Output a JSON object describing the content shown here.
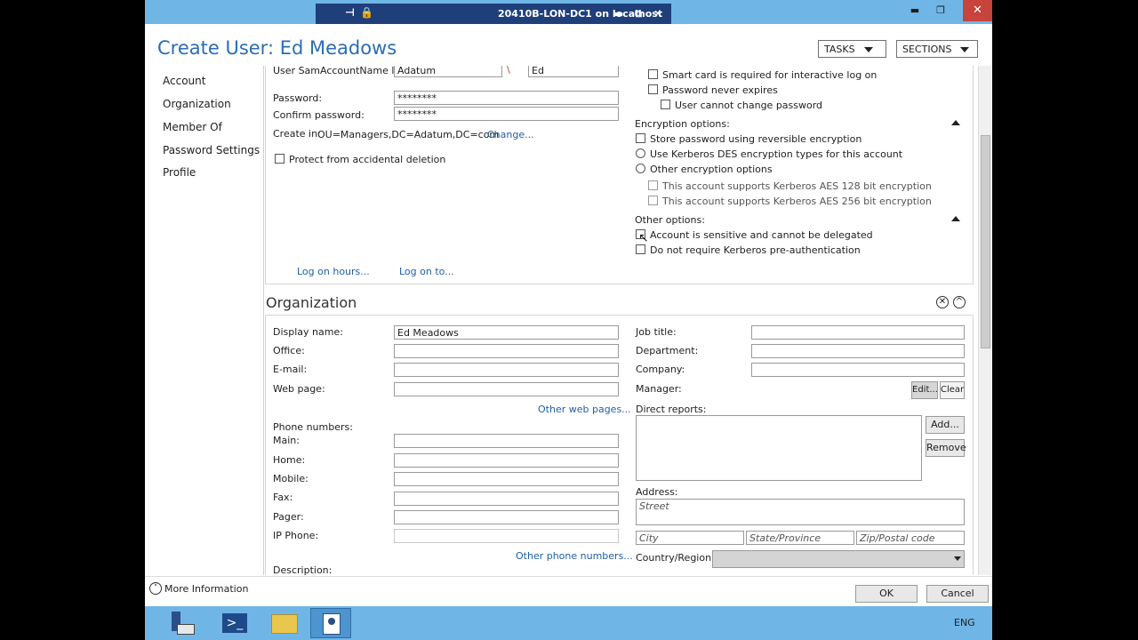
{
  "window": {
    "title": "20410B-LON-DC1 on localhost",
    "close_glyph": "✕",
    "min_glyph": "▬",
    "max_glyph": "❐",
    "restore_glyph": "⧉",
    "pin_glyph": "⊣",
    "lock_glyph": "🔒"
  },
  "header": {
    "title": "Create User: Ed Meadows",
    "tasks_label": "TASKS",
    "sections_label": "SECTIONS"
  },
  "nav": {
    "items": [
      "Account",
      "Organization",
      "Member Of",
      "Password Settings",
      "Profile"
    ]
  },
  "account": {
    "sam_label": "User SamAccountName l...",
    "sam_domain": "Adatum",
    "sam_separator": "\\",
    "sam_user": "Ed",
    "password_label": "Password:",
    "password_value": "********",
    "confirm_label": "Confirm password:",
    "confirm_value": "********",
    "create_in_label": "Create in:",
    "create_in_value": "OU=Managers,DC=Adatum,DC=com",
    "change_link": "Change...",
    "protect_label": "Protect from accidental deletion",
    "smart_card": "Smart card is required for interactive log on",
    "pwd_never_expires": "Password never expires",
    "cannot_change": "User cannot change password",
    "encryption_header": "Encryption options:",
    "reversible": "Store password using reversible encryption",
    "kerberos_des": "Use Kerberos DES encryption types for this account",
    "other_encryption": "Other encryption options",
    "aes128": "This account supports Kerberos AES 128 bit encryption",
    "aes256": "This account supports Kerberos AES 256 bit encryption",
    "other_options_header": "Other options:",
    "sensitive": "Account is sensitive and cannot be delegated",
    "no_preauth": "Do not require Kerberos pre-authentication",
    "logon_hours": "Log on hours...",
    "logon_to": "Log on to..."
  },
  "organization": {
    "title": "Organization",
    "display_name_label": "Display name:",
    "display_name_value": "Ed Meadows",
    "office_label": "Office:",
    "email_label": "E-mail:",
    "webpage_label": "Web page:",
    "other_web": "Other web pages...",
    "phone_numbers_label": "Phone numbers:",
    "main_label": "Main:",
    "home_label": "Home:",
    "mobile_label": "Mobile:",
    "fax_label": "Fax:",
    "pager_label": "Pager:",
    "ipphone_label": "IP Phone:",
    "other_phone": "Other phone numbers...",
    "description_label": "Description:",
    "job_title_label": "Job title:",
    "department_label": "Department:",
    "company_label": "Company:",
    "manager_label": "Manager:",
    "edit_btn": "Edit...",
    "clear_btn": "Clear",
    "direct_reports_label": "Direct reports:",
    "add_btn": "Add...",
    "remove_btn": "Remove",
    "address_label": "Address:",
    "street_placeholder": "Street",
    "city_placeholder": "City",
    "state_placeholder": "State/Province",
    "zip_placeholder": "Zip/Postal code",
    "country_label": "Country/Region:",
    "close_glyph": "✕",
    "collapse_glyph": "^"
  },
  "footer": {
    "more_info": "More Information",
    "ok": "OK",
    "cancel": "Cancel",
    "more_glyph": "˅"
  },
  "taskbar": {
    "lang": "ENG"
  },
  "colors": {
    "accent": "#2a6db5",
    "titlebar": "#6fb6e6",
    "rdp_tab": "#1f3f7a",
    "link": "#1e5fa8"
  }
}
